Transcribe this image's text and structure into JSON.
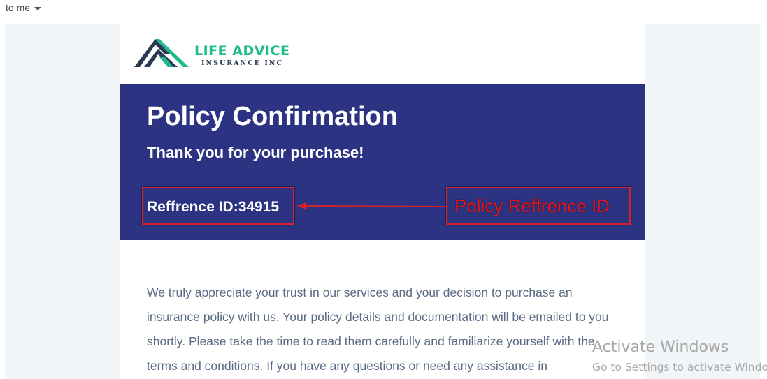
{
  "email_header": {
    "recipient": "to me"
  },
  "logo": {
    "name": "LIFE ADVICE",
    "subtitle": "INSURANCE INC",
    "icon": "mountain-logo-icon"
  },
  "banner": {
    "title": "Policy Confirmation",
    "subtitle": "Thank you for your purchase!",
    "reference": "Reffrence ID:34915"
  },
  "annotation": {
    "label": "Policy Reffrence ID",
    "color": "#e0151d"
  },
  "body": {
    "lines": [
      "We truly appreciate your trust in our services and your decision to purchase an",
      "insurance policy with us. Your policy details and documentation will be emailed to you",
      "shortly. Please take the time to read them carefully and familiarize yourself with the",
      "terms and conditions. If you have any questions or need any assistance in"
    ]
  },
  "watermark": {
    "title": "Activate Windows",
    "subtitle": "Go to Settings to activate Windows."
  },
  "colors": {
    "banner": "#2b3382",
    "logo_accent": "#1dbb8c",
    "logo_dark": "#2a3a52",
    "body_text": "#5a6b85",
    "outer_bg": "#f2f5f8"
  }
}
